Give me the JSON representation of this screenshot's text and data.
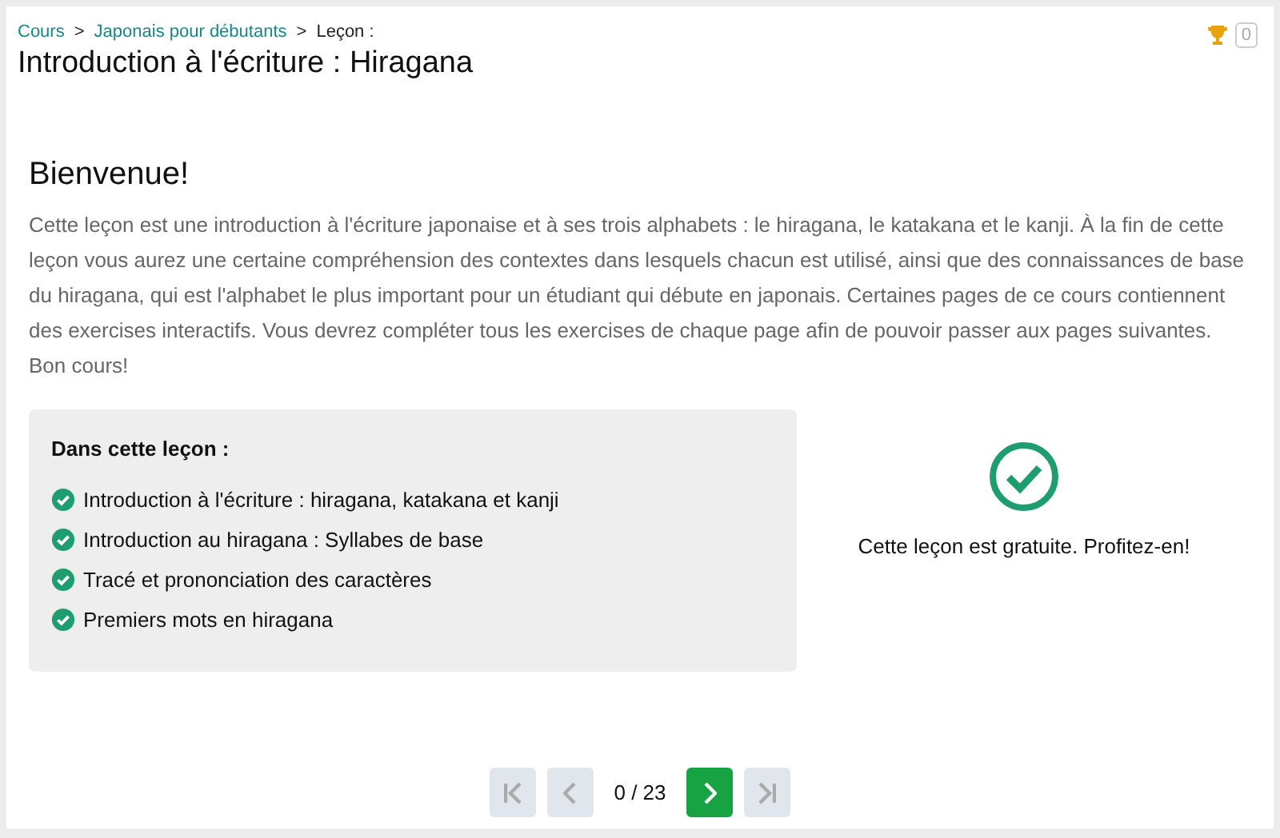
{
  "breadcrumb": [
    {
      "label": "Cours",
      "link": true
    },
    {
      "label": "Japonais pour débutants",
      "link": true
    },
    {
      "label": "Leçon :",
      "link": false
    }
  ],
  "separator": ">",
  "title": "Introduction à l'écriture : Hiragana",
  "trophy_count": "0",
  "heading": "Bienvenue!",
  "intro": "Cette leçon est une introduction à l'écriture japonaise et à ses trois alphabets : le hiragana, le katakana et le kanji. À la fin de cette leçon vous aurez une certaine compréhension des contextes dans lesquels chacun est utilisé, ainsi que des connaissances de base du hiragana, qui est l'alphabet le plus important pour un étudiant qui débute en japonais. Certaines pages de ce cours contiennent des exercises interactifs. Vous devrez compléter tous les exercises de chaque page afin de pouvoir passer aux pages suivantes. Bon cours!",
  "contents": {
    "title": "Dans cette leçon :",
    "items": [
      {
        "label": "Introduction à l'écriture : hiragana, katakana et kanji",
        "checked": true
      },
      {
        "label": "Introduction au hiragana : Syllabes de base",
        "checked": true
      },
      {
        "label": "Tracé et prononciation des caractères",
        "checked": true
      },
      {
        "label": "Premiers mots en hiragana",
        "checked": true
      }
    ]
  },
  "status": "Cette leçon est gratuite. Profitez-en!",
  "pager": {
    "position": "0 / 23",
    "buttons": [
      {
        "kind": "first",
        "disabled": true
      },
      {
        "kind": "prev",
        "disabled": true
      },
      {
        "kind": "next",
        "disabled": false
      },
      {
        "kind": "last",
        "disabled": true
      }
    ]
  }
}
